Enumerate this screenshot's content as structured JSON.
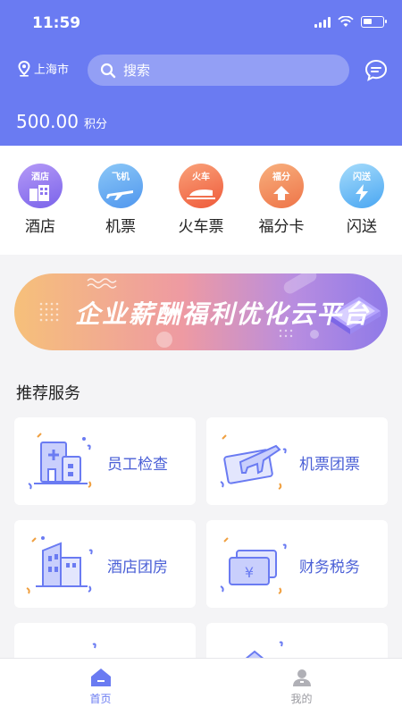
{
  "status_bar": {
    "time": "11:59"
  },
  "header": {
    "location": "上海市",
    "search_placeholder": "搜索",
    "points_value": "500.00",
    "points_unit": "积分"
  },
  "categories": [
    {
      "tag": "酒店",
      "label": "酒店",
      "color": "#8c74f0"
    },
    {
      "tag": "飞机",
      "label": "机票",
      "color": "#5aa7f2"
    },
    {
      "tag": "火车",
      "label": "火车票",
      "color": "#f5754e"
    },
    {
      "tag": "福分",
      "label": "福分卡",
      "color": "#f08a5c"
    },
    {
      "tag": "闪送",
      "label": "闪送",
      "color": "#62b8f5"
    }
  ],
  "banner": {
    "text": "企业薪酬福利优化云平台"
  },
  "recommend": {
    "title": "推荐服务",
    "items": [
      {
        "label": "员工检查"
      },
      {
        "label": "机票团票"
      },
      {
        "label": "酒店团房"
      },
      {
        "label": "财务税务"
      }
    ]
  },
  "tabbar": {
    "home": "首页",
    "me": "我的"
  },
  "colors": {
    "accent": "#6a7bf2",
    "card_text": "#4a5fd6"
  }
}
